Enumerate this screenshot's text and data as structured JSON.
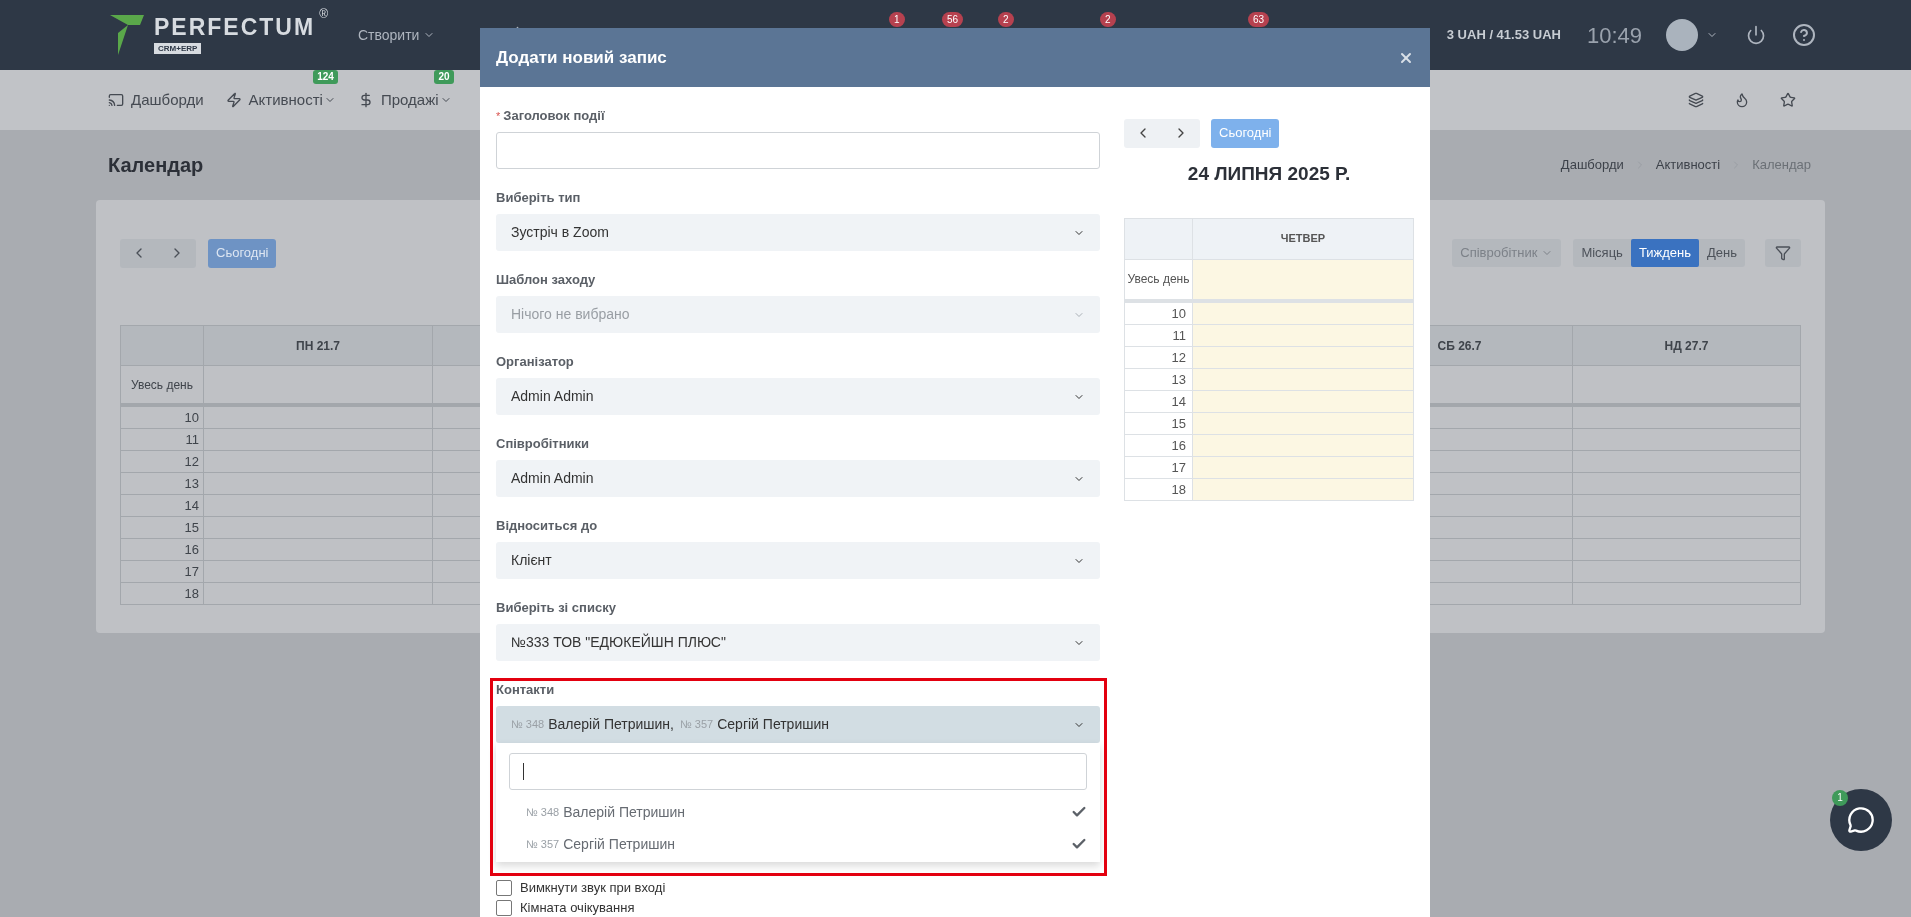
{
  "topbar": {
    "brand": "PERFECTUM",
    "brand_mark": "®",
    "brand_sub": "CRM+ERP",
    "create_menu": "Створити",
    "badges": [
      {
        "count": "1"
      },
      {
        "count": "56"
      },
      {
        "count": "2"
      },
      {
        "count": "2"
      },
      {
        "count": "63"
      }
    ],
    "balance": "3 UAH / 41.53 UAH",
    "time": "10:49"
  },
  "nav": [
    {
      "kind": "dashboard",
      "label": "Дашборди"
    },
    {
      "kind": "activity",
      "label": "Активності",
      "badge": "124"
    },
    {
      "kind": "sales",
      "label": "Продажі",
      "badge": "20"
    }
  ],
  "page": {
    "title": "Календар",
    "breadcrumbs": [
      "Дашборди",
      "Активності",
      "Календар"
    ]
  },
  "calendar": {
    "today": "Сьогодні",
    "employee_filter": "Співробітник",
    "views": [
      {
        "label": "Місяць",
        "selected": false
      },
      {
        "label": "Тиждень",
        "selected": true
      },
      {
        "label": "День",
        "selected": false
      }
    ],
    "columns": [
      "ПН 21.7",
      "СБ 26.7",
      "НД 27.7"
    ],
    "all_day": "Увесь день",
    "hours": [
      "10",
      "11",
      "12",
      "13",
      "14",
      "15",
      "16",
      "17",
      "18"
    ]
  },
  "modal": {
    "title": "Додати новий запис",
    "fields": [
      {
        "kind": "text",
        "label": "Заголовок події",
        "required_mark": "*"
      },
      {
        "kind": "select",
        "label": "Виберіть тип",
        "value": "Зустріч в Zoom"
      },
      {
        "kind": "select",
        "label": "Шаблон заходу",
        "placeholder": "Нічого не вибрано"
      },
      {
        "kind": "select",
        "label": "Організатор",
        "value": "Admin Admin"
      },
      {
        "kind": "select",
        "label": "Співробітники",
        "value": "Admin Admin"
      },
      {
        "kind": "select",
        "label": "Відноситься до",
        "value": "Клієнт"
      },
      {
        "kind": "select",
        "label": "Виберіть зі списку",
        "value": "№333 ТОВ \"ЕДЮКЕЙШН ПЛЮС\""
      }
    ],
    "contacts": {
      "label": "Контакти",
      "expanded": true,
      "chosen": [
        {
          "number": "№ 348",
          "name": "Валерій Петришин,"
        },
        {
          "number": "№ 357",
          "name": "Сергій Петришин"
        }
      ],
      "options": [
        {
          "number": "№ 348",
          "name": "Валерій Петришин",
          "selected": true
        },
        {
          "number": "№ 357",
          "name": "Сергій Петришин",
          "selected": true
        }
      ]
    },
    "checkboxes": [
      {
        "label": "Вимкнути звук при вході",
        "checked": false
      },
      {
        "label": "Кімната очікування",
        "checked": false
      }
    ],
    "day_view": {
      "today": "Сьогодні",
      "date": "24 ЛИПНЯ 2025 Р.",
      "weekday": "ЧЕТВЕР",
      "all_day": "Увесь день",
      "hours": [
        "10",
        "11",
        "12",
        "13",
        "14",
        "15",
        "16",
        "17",
        "18"
      ]
    }
  },
  "chat": {
    "badge": "1"
  }
}
